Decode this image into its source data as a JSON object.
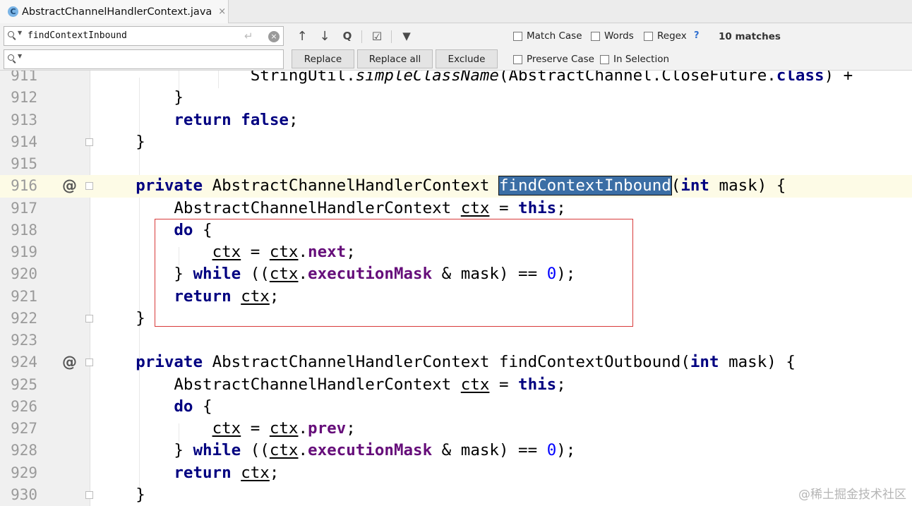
{
  "tab": {
    "icon_letter": "C",
    "label": "AbstractChannelHandlerContext.java",
    "close": "×"
  },
  "find": {
    "search_value": "findContextInbound",
    "replace_value": "",
    "enter_icon": "↵",
    "clear_icon": "×",
    "tools": {
      "prev": "↑",
      "next": "↓",
      "select_all": "Q",
      "multiline": "☑",
      "filter": "▼"
    },
    "buttons": {
      "replace": "Replace",
      "replace_all": "Replace all",
      "exclude": "Exclude"
    },
    "options": {
      "match_case": "Match Case",
      "words": "Words",
      "regex": "Regex",
      "help": "?",
      "preserve_case": "Preserve Case",
      "in_selection": "In Selection"
    },
    "match_count": "10 matches"
  },
  "editor": {
    "lines": [
      {
        "n": "911",
        "anno": "",
        "fold": false
      },
      {
        "n": "912",
        "anno": "",
        "fold": false
      },
      {
        "n": "913",
        "anno": "",
        "fold": false
      },
      {
        "n": "914",
        "anno": "",
        "fold": true
      },
      {
        "n": "915",
        "anno": "",
        "fold": false
      },
      {
        "n": "916",
        "anno": "@",
        "fold": true
      },
      {
        "n": "917",
        "anno": "",
        "fold": false
      },
      {
        "n": "918",
        "anno": "",
        "fold": false
      },
      {
        "n": "919",
        "anno": "",
        "fold": false
      },
      {
        "n": "920",
        "anno": "",
        "fold": false
      },
      {
        "n": "921",
        "anno": "",
        "fold": false
      },
      {
        "n": "922",
        "anno": "",
        "fold": true
      },
      {
        "n": "923",
        "anno": "",
        "fold": false
      },
      {
        "n": "924",
        "anno": "@",
        "fold": true
      },
      {
        "n": "925",
        "anno": "",
        "fold": false
      },
      {
        "n": "926",
        "anno": "",
        "fold": false
      },
      {
        "n": "927",
        "anno": "",
        "fold": false
      },
      {
        "n": "928",
        "anno": "",
        "fold": false
      },
      {
        "n": "929",
        "anno": "",
        "fold": false
      },
      {
        "n": "930",
        "anno": "",
        "fold": true
      }
    ],
    "tokens": {
      "t_stringutil": "StringUtil.",
      "t_simpleclassname": "simpleClassName",
      "t_abstractchannel": "(AbstractChannel.CloseFuture.",
      "t_class": "class",
      "t_tail911": ") +",
      "brace_close": "}",
      "kw_return": "return",
      "kw_false": "false",
      "semi": ";",
      "kw_private": "private",
      "type_ctxclass": "AbstractChannelHandlerContext",
      "method_inbound": "findContextInbound",
      "method_outbound": "findContextOutbound",
      "paren_open": "(",
      "kw_int": "int",
      "param_tail": " mask) {",
      "var_ctx": "ctx",
      "assign": " = ",
      "kw_this": "this",
      "kw_do": "do",
      "brace_open_sp": " {",
      "dot": ".",
      "fld_next": "next",
      "fld_prev": "prev",
      "brace_close_sp": "} ",
      "kw_while": "while",
      "while_open": " ((",
      "fld_mask": "executionMask",
      "and_mask": " & mask) == ",
      "num_zero": "0",
      "close_paren_semi": ");",
      "sp": " "
    }
  },
  "watermark": "@稀土掘金技术社区"
}
